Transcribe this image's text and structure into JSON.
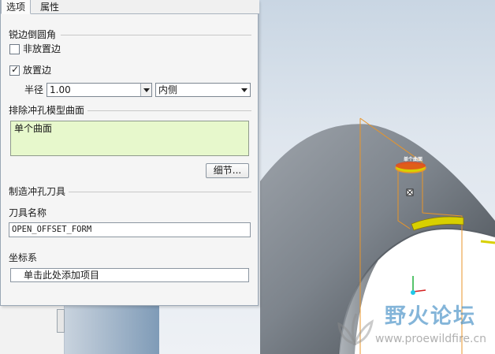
{
  "tabs": [
    {
      "label": "选项",
      "active": true
    },
    {
      "label": "属性",
      "active": false
    }
  ],
  "sharp_edge": {
    "title": "锐边倒圆角",
    "non_placement_label": "非放置边",
    "non_placement_checked": false,
    "placement_label": "放置边",
    "placement_checked": true,
    "radius_label": "半径",
    "radius_value": "1.00",
    "side_value": "内侧"
  },
  "exclude": {
    "title": "排除冲孔模型曲面",
    "surface_item": "单个曲面",
    "detail_button": "细节..."
  },
  "tool": {
    "title": "制造冲孔刀具",
    "name_label": "刀具名称",
    "name_value": "OPEN_OFFSET_FORM"
  },
  "csys": {
    "title": "坐标系",
    "placeholder": "单击此处添加项目"
  },
  "viewport": {
    "surface_tag": "单个曲面"
  },
  "watermark": {
    "title": "野火论坛",
    "url": "www.proewildfire.cn"
  },
  "colors": {
    "panel_bg": "#f5f5f5",
    "surface_box_bg": "#e7f8cc",
    "datum_orange": "#e8952a",
    "feature_yellow": "#d8d000",
    "watermark_blue": "#428ec4"
  }
}
